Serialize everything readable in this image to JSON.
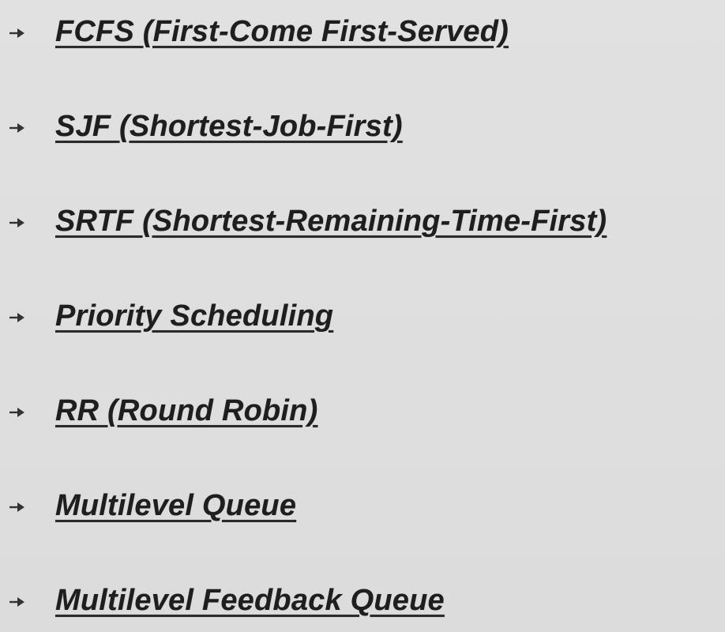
{
  "slide": {
    "bullet_icon": "right-arrow-icon",
    "items": [
      {
        "label": "FCFS (First-Come First-Served)"
      },
      {
        "label": "SJF (Shortest-Job-First)"
      },
      {
        "label": "SRTF (Shortest-Remaining-Time-First)"
      },
      {
        "label": "Priority Scheduling"
      },
      {
        "label": "RR (Round Robin)"
      },
      {
        "label": "Multilevel Queue"
      },
      {
        "label": "Multilevel Feedback Queue"
      }
    ]
  },
  "colors": {
    "background": "#dedede",
    "text": "#1e1e1e"
  }
}
